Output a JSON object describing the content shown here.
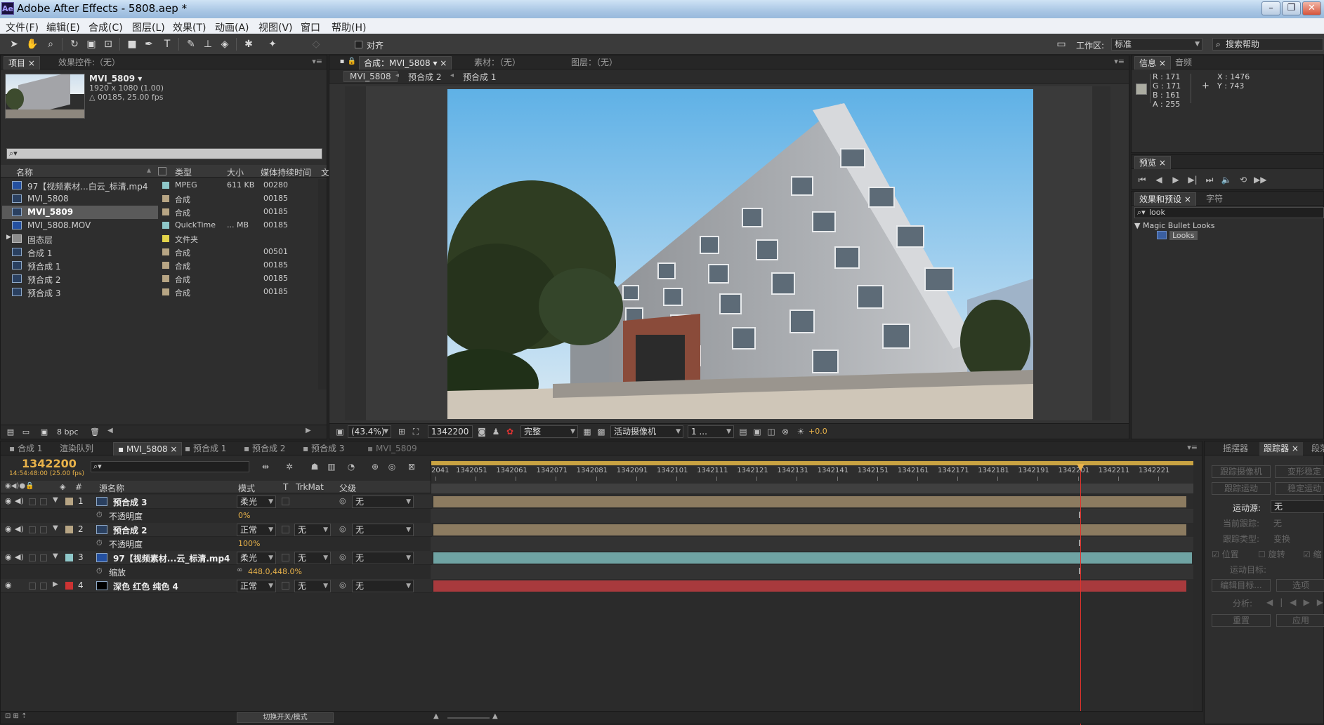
{
  "window": {
    "title": "Adobe After Effects - 5808.aep *",
    "app_icon": "Ae"
  },
  "menu": [
    "文件(F)",
    "编辑(E)",
    "合成(C)",
    "图层(L)",
    "效果(T)",
    "动画(A)",
    "视图(V)",
    "窗口",
    "帮助(H)"
  ],
  "toolbar": {
    "align_label": "对齐",
    "workspace_label": "工作区:",
    "workspace_value": "标准",
    "search_placeholder": "搜索帮助"
  },
  "project_panel": {
    "tabs": [
      "项目",
      "效果控件:（无）"
    ],
    "item_name": "MVI_5809 ▾",
    "item_size": "1920 x 1080 (1.00)",
    "item_duration": "△ 00185, 25.00 fps",
    "search_icon": "⌕▾",
    "columns": [
      "名称",
      "类型",
      "大小",
      "媒体持续时间",
      "文"
    ],
    "rows": [
      {
        "name": "97【视频素材...白云_标清.mp4",
        "type": "MPEG",
        "size": "611 KB",
        "duration": "00280",
        "color": "#8ec7c9",
        "icon": "film"
      },
      {
        "name": "MVI_5808",
        "type": "合成",
        "size": "",
        "duration": "00185",
        "color": "#b7a584",
        "icon": "comp"
      },
      {
        "name": "MVI_5809",
        "type": "合成",
        "size": "",
        "duration": "00185",
        "color": "#b7a584",
        "icon": "comp",
        "selected": true
      },
      {
        "name": "MVI_5808.MOV",
        "type": "QuickTime",
        "size": "... MB",
        "duration": "00185",
        "color": "#8ec7c9",
        "icon": "film"
      },
      {
        "name": "固态层",
        "type": "文件夹",
        "size": "",
        "duration": "",
        "color": "#e3d44a",
        "icon": "folder"
      },
      {
        "name": "合成 1",
        "type": "合成",
        "size": "",
        "duration": "00501",
        "color": "#b7a584",
        "icon": "comp"
      },
      {
        "name": "预合成 1",
        "type": "合成",
        "size": "",
        "duration": "00185",
        "color": "#b7a584",
        "icon": "comp"
      },
      {
        "name": "预合成 2",
        "type": "合成",
        "size": "",
        "duration": "00185",
        "color": "#b7a584",
        "icon": "comp"
      },
      {
        "name": "预合成 3",
        "type": "合成",
        "size": "",
        "duration": "00185",
        "color": "#b7a584",
        "icon": "comp"
      }
    ],
    "bpc": "8 bpc"
  },
  "comp_panel": {
    "tabs": [
      "合成：MVI_5808",
      "素材：（无）",
      "图层：（无）"
    ],
    "breadcrumbs": [
      "MVI_5808",
      "预合成 2",
      "预合成 1"
    ],
    "zoom": "(43.4%)",
    "timecode": "1342200",
    "resolution": "完整",
    "camera": "活动摄像机",
    "views": "1 ...",
    "exposure": "+0.0"
  },
  "info_panel": {
    "tabs": [
      "信息",
      "音频"
    ],
    "r": "R : 171",
    "g": "G : 171",
    "b": "B : 161",
    "a": "A : 255",
    "x": "X : 1476",
    "y": "Y : 743",
    "swatch": "#abab a1"
  },
  "preview_panel": {
    "tabs": [
      "预览"
    ]
  },
  "effects_panel": {
    "tabs": [
      "效果和预设",
      "字符"
    ],
    "search": "look",
    "group": "Magic Bullet Looks",
    "item": "Looks"
  },
  "timeline": {
    "tabs": [
      "合成 1",
      "渲染队列",
      "MVI_5808",
      "预合成 1",
      "预合成 2",
      "预合成 3",
      "MVI_5809"
    ],
    "timecode": "1342200",
    "timecode_sub": "14:54:48:00 (25.00 fps)",
    "headers": {
      "source": "源名称",
      "mode": "模式",
      "t": "T",
      "trkmat": "TrkMat",
      "parent": "父级",
      "num": "#"
    },
    "ruler": [
      "2041",
      "1342051",
      "1342061",
      "1342071",
      "1342081",
      "1342091",
      "1342101",
      "1342111",
      "1342121",
      "1342131",
      "1342141",
      "1342151",
      "1342161",
      "1342171",
      "1342181",
      "1342191",
      "1342201",
      "1342211",
      "1342221"
    ],
    "layers": [
      {
        "num": "1",
        "name": "预合成 3",
        "mode": "柔光",
        "trk": "",
        "parent": "无",
        "color": "#b7a584",
        "bar": "#8c7b60",
        "prop": "不透明度",
        "prop_val": "0%"
      },
      {
        "num": "2",
        "name": "预合成 2",
        "mode": "正常",
        "trk": "无",
        "parent": "无",
        "color": "#b7a584",
        "bar": "#8c7b60",
        "prop": "不透明度",
        "prop_val": "100%"
      },
      {
        "num": "3",
        "name": "97【视频素材...云_标清.mp4",
        "mode": "柔光",
        "trk": "无",
        "parent": "无",
        "color": "#8ec7c9",
        "bar": "#6fa3a3",
        "prop": "缩放",
        "prop_val": "448.0,448.0%"
      },
      {
        "num": "4",
        "name": "深色 红色 纯色 4",
        "mode": "正常",
        "trk": "无",
        "parent": "无",
        "color": "#cc3333",
        "bar": "#a83a3d"
      }
    ],
    "toggle_label": "切换开关/模式"
  },
  "tracker_panel": {
    "tabs": [
      "摇摆器",
      "跟踪器",
      "段落"
    ],
    "buttons": [
      "跟踪摄像机",
      "变形稳定",
      "跟踪运动",
      "稳定运动"
    ],
    "motion_source_label": "运动源:",
    "motion_source_value": "无",
    "current_track_label": "当前跟踪:",
    "current_track_value": "无",
    "track_type_label": "跟踪类型:",
    "track_type_value": "变换",
    "checks": [
      "位置",
      "旋转",
      "缩"
    ],
    "target_label": "运动目标:",
    "edit_target": "编辑目标...",
    "options": "选项",
    "analyze_label": "分析:",
    "reset": "重置",
    "apply": "应用"
  }
}
